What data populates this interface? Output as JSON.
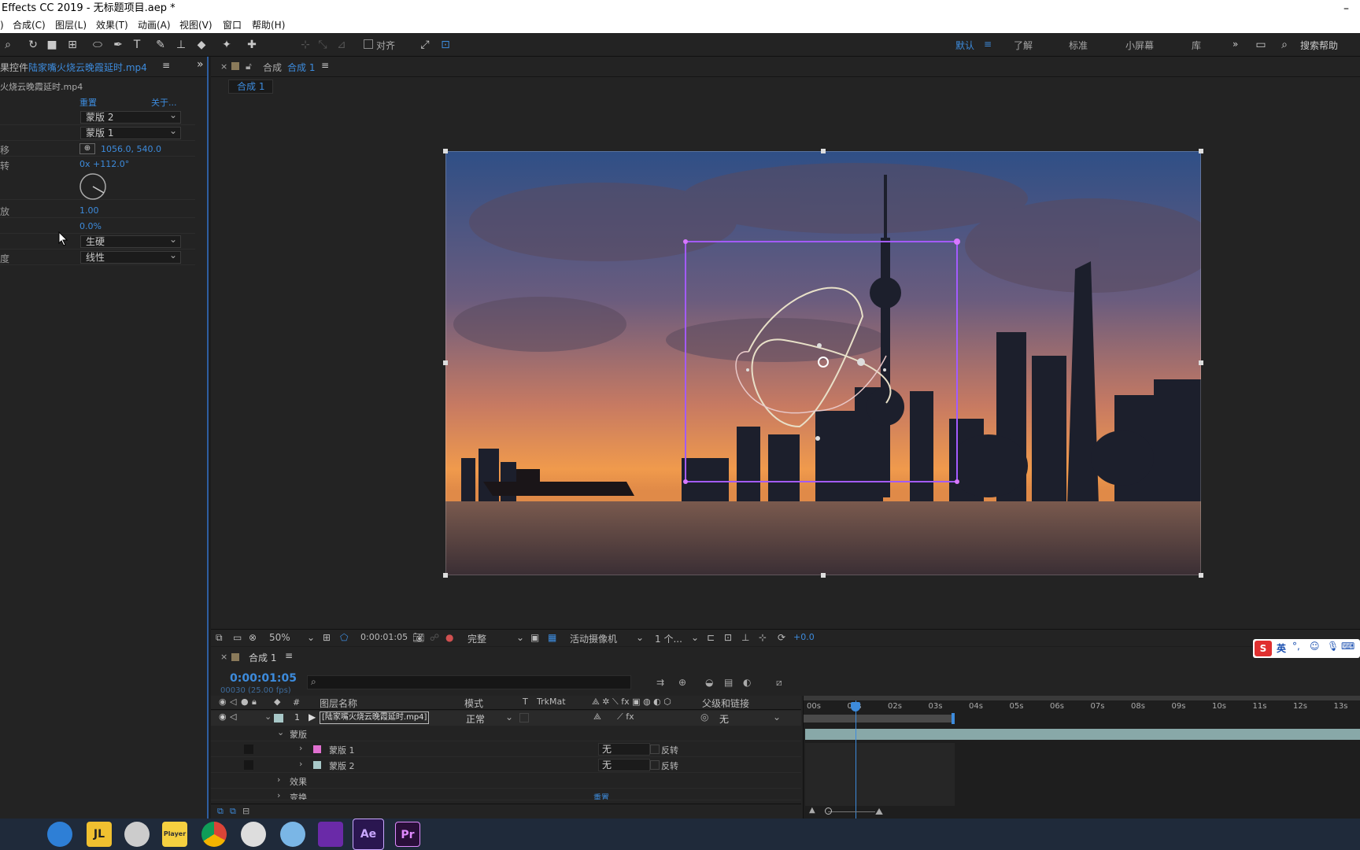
{
  "window": {
    "title": "Effects CC 2019 - 无标题项目.aep *",
    "minimize": "–"
  },
  "menu": [
    "合成(C)",
    "图层(L)",
    "效果(T)",
    "动画(A)",
    "视图(V)",
    "窗口",
    "帮助(H)"
  ],
  "menu_prefix": ")",
  "toolbar": {
    "align_label": "对齐",
    "workspaces": [
      "默认",
      "了解",
      "标准",
      "小屏幕",
      "库"
    ],
    "workspace_active": "默认",
    "more": "»",
    "search_placeholder": "搜索帮助"
  },
  "effects_panel": {
    "tab_prefix": "果控件",
    "tab_file": "陆家嘴火烧云晚霞延时.mp4",
    "subtitle": "火烧云晚霞延时.mp4",
    "reset": "重置",
    "about": "关于...",
    "rows": [
      {
        "label": "",
        "dropdown": "蒙版 2"
      },
      {
        "label": "",
        "dropdown": "蒙版 1"
      },
      {
        "label": "移",
        "value": "1056.0, 540.0"
      },
      {
        "label": "转",
        "value": "0x +112.0°"
      },
      {
        "label": "放",
        "value": "1.00"
      },
      {
        "label": "",
        "value": "0.0%"
      },
      {
        "label": "",
        "dropdown": "生硬"
      },
      {
        "label": "度",
        "dropdown": "线性"
      }
    ]
  },
  "viewer": {
    "tab_label": "合成",
    "tab_comp": "合成 1",
    "breadcrumb": "合成 1",
    "zoom": "50%",
    "timecode": "0:00:01:05",
    "resolution": "完整",
    "camera": "活动摄像机",
    "views": "1 个...",
    "exposure": "+0.0"
  },
  "timeline": {
    "tab": "合成 1",
    "timecode": "0:00:01:05",
    "frame_info": "00030 (25.00 fps)",
    "columns": {
      "name": "图层名称",
      "mode": "模式",
      "t": "T",
      "trkmat": "TrkMat",
      "parent": "父级和链接"
    },
    "layer": {
      "index": "1",
      "name": "[陆家嘴火烧云晚霞延时.mp4]",
      "mode": "正常",
      "parent": "无"
    },
    "groups": {
      "masks": "蒙版",
      "effects": "效果",
      "transform": "变换",
      "reset": "重置"
    },
    "masks": [
      {
        "name": "蒙版 1",
        "mode": "无",
        "invert": "反转",
        "color": "#e070d0"
      },
      {
        "name": "蒙版 2",
        "mode": "无",
        "invert": "反转",
        "color": "#a8c8c8"
      }
    ],
    "ruler": [
      "00s",
      "01s",
      "02s",
      "03s",
      "04s",
      "05s",
      "06s",
      "07s",
      "08s",
      "09s",
      "10s",
      "11s",
      "12s",
      "13s"
    ],
    "playhead_seconds": 1.2
  },
  "ime": {
    "label": "英"
  },
  "taskbar": [
    {
      "name": "start",
      "label": ""
    },
    {
      "name": "qq",
      "label": ""
    },
    {
      "name": "jl",
      "label": "JL"
    },
    {
      "name": "app3",
      "label": ""
    },
    {
      "name": "player",
      "label": "Player"
    },
    {
      "name": "chrome",
      "label": ""
    },
    {
      "name": "app6",
      "label": ""
    },
    {
      "name": "app7",
      "label": ""
    },
    {
      "name": "app8",
      "label": ""
    },
    {
      "name": "ae",
      "label": "Ae"
    },
    {
      "name": "pr",
      "label": "Pr"
    }
  ],
  "colors": {
    "accent": "#3d8bdc",
    "mask_path": "#a35bff",
    "bg": "#1d1d1d",
    "panel": "#232323"
  }
}
